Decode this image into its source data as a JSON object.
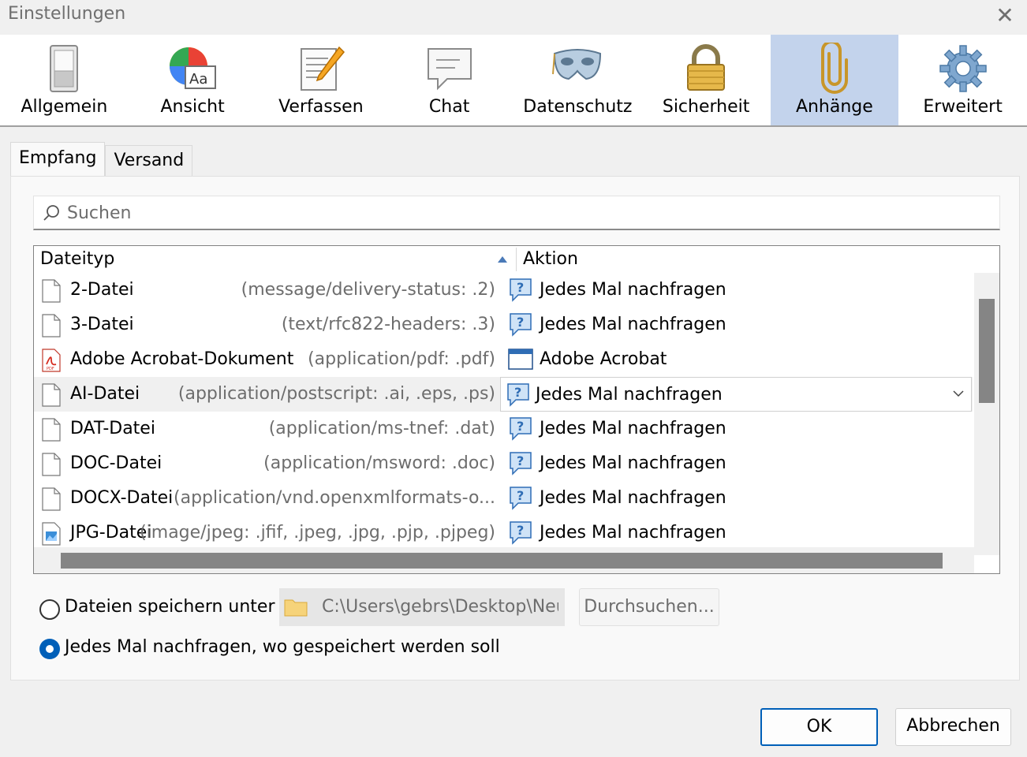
{
  "window": {
    "title": "Einstellungen",
    "close_glyph": "✕"
  },
  "toolbar": [
    {
      "label": "Allgemein",
      "icon": "switch-icon",
      "active": false
    },
    {
      "label": "Ansicht",
      "icon": "color-font-icon",
      "active": false
    },
    {
      "label": "Verfassen",
      "icon": "compose-icon",
      "active": false
    },
    {
      "label": "Chat",
      "icon": "chat-bubble-icon",
      "active": false
    },
    {
      "label": "Datenschutz",
      "icon": "mask-icon",
      "active": false
    },
    {
      "label": "Sicherheit",
      "icon": "padlock-icon",
      "active": false
    },
    {
      "label": "Anhänge",
      "icon": "paperclip-icon",
      "active": true
    },
    {
      "label": "Erweitert",
      "icon": "gear-icon",
      "active": false
    }
  ],
  "tabs": [
    {
      "label": "Empfang",
      "active": true
    },
    {
      "label": "Versand",
      "active": false
    }
  ],
  "search": {
    "placeholder": "Suchen",
    "value": ""
  },
  "table": {
    "columns": [
      "Dateityp",
      "Aktion"
    ],
    "sort_column": "Dateityp",
    "rows": [
      {
        "type": "2-Datei",
        "mime": "(message/delivery-status: .2)",
        "action": "Jedes Mal nachfragen",
        "file_icon": "document-icon",
        "action_icon": "question-icon",
        "selected": false
      },
      {
        "type": "3-Datei",
        "mime": "(text/rfc822-headers: .3)",
        "action": "Jedes Mal nachfragen",
        "file_icon": "document-icon",
        "action_icon": "question-icon",
        "selected": false
      },
      {
        "type": "Adobe Acrobat-Dokument",
        "mime": "(application/pdf: .pdf)",
        "action": "Adobe Acrobat",
        "file_icon": "pdf-icon",
        "action_icon": "application-window-icon",
        "selected": false
      },
      {
        "type": "AI-Datei",
        "mime": "(application/postscript: .ai, .eps, .ps)",
        "action": "Jedes Mal nachfragen",
        "file_icon": "document-icon",
        "action_icon": "question-icon",
        "selected": true
      },
      {
        "type": "DAT-Datei",
        "mime": "(application/ms-tnef: .dat)",
        "action": "Jedes Mal nachfragen",
        "file_icon": "document-icon",
        "action_icon": "question-icon",
        "selected": false
      },
      {
        "type": "DOC-Datei",
        "mime": "(application/msword: .doc)",
        "action": "Jedes Mal nachfragen",
        "file_icon": "document-icon",
        "action_icon": "question-icon",
        "selected": false
      },
      {
        "type": "DOCX-Datei",
        "mime": "(application/vnd.openxmlformats-o...",
        "action": "Jedes Mal nachfragen",
        "file_icon": "document-icon",
        "action_icon": "question-icon",
        "selected": false
      },
      {
        "type": "JPG-Datei",
        "mime": "(image/jpeg: .jfif, .jpeg, .jpg, .pjp, .pjpeg)",
        "action": "Jedes Mal nachfragen",
        "file_icon": "image-file-icon",
        "action_icon": "question-icon",
        "selected": false
      }
    ]
  },
  "save": {
    "option_save_to_label": "Dateien speichern unter",
    "option_save_to_checked": false,
    "path": "C:\\Users\\gebrs\\Desktop\\Neu",
    "browse_label": "Durchsuchen...",
    "option_ask_label": "Jedes Mal nachfragen, wo gespeichert werden soll",
    "option_ask_checked": true
  },
  "buttons": {
    "ok": "OK",
    "cancel": "Abbrechen"
  },
  "colors": {
    "accent": "#005fb8",
    "active_tab_bg": "#c3d3ec"
  }
}
